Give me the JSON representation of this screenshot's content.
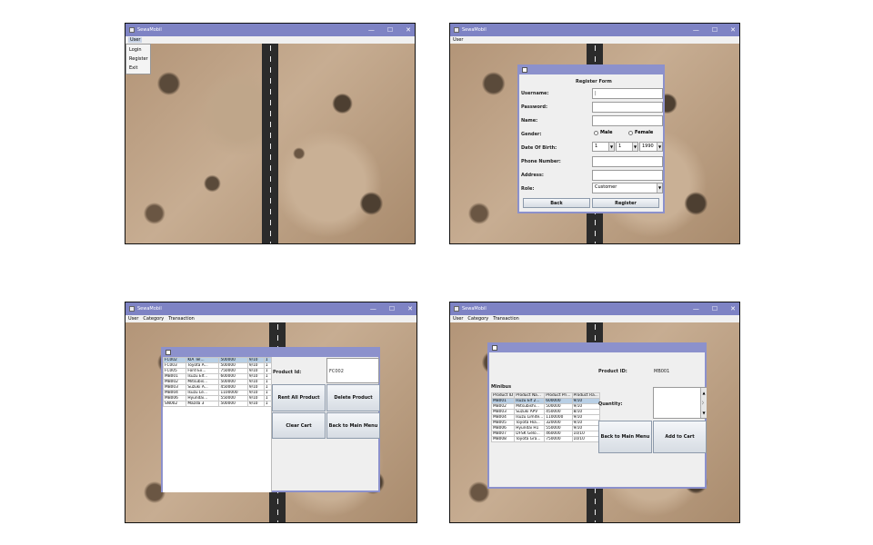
{
  "app_title": "SewaMobil",
  "window_controls": {
    "minimize": "—",
    "maximize": "☐",
    "close": "✕"
  },
  "panel1": {
    "menu": [
      "User"
    ],
    "dropdown": [
      "Login",
      "Register",
      "Exit"
    ]
  },
  "panel2": {
    "menu": [
      "User"
    ],
    "form_title": "Register Form",
    "labels": {
      "username": "Username:",
      "password": "Password:",
      "name": "Name:",
      "gender": "Gender:",
      "dob": "Date Of Birth:",
      "phone": "Phone Number:",
      "address": "Address:",
      "role": "Role:"
    },
    "gender_options": [
      "Male",
      "Female"
    ],
    "dob": {
      "day": "1",
      "month": "1",
      "year": "1990"
    },
    "role_value": "Customer",
    "back_button": "Back",
    "register_button": "Register"
  },
  "panel3": {
    "menu": [
      "User",
      "Category",
      "Transaction"
    ],
    "rows": [
      [
        "FC002",
        "KIA Tel...",
        "500000",
        "9/10",
        "1"
      ],
      [
        "FC003",
        "Toyota A...",
        "500000",
        "9/10",
        "1"
      ],
      [
        "FC005",
        "Ford Ex...",
        "750000",
        "9/10",
        "1"
      ],
      [
        "MB001",
        "Isuzu Elf...",
        "600000",
        "9/10",
        "1"
      ],
      [
        "MB002",
        "Mitsubis...",
        "500000",
        "9/10",
        "1"
      ],
      [
        "MB003",
        "Suzuki A...",
        "450000",
        "9/10",
        "1"
      ],
      [
        "MB004",
        "Isuzu Le...",
        "1100000",
        "9/10",
        "1"
      ],
      [
        "MB006",
        "Hyundai...",
        "550000",
        "9/10",
        "1"
      ],
      [
        "SN002",
        "Mazda 3",
        "500000",
        "9/10",
        "1"
      ]
    ],
    "product_id_label": "Product Id:",
    "product_id_value": "FC002",
    "rent_all_button": "Rent All Product",
    "delete_button": "Delete Product",
    "clear_cart_button": "Clear Cart",
    "back_menu_button": "Back to Main Menu"
  },
  "panel4": {
    "menu": [
      "User",
      "Category",
      "Transaction"
    ],
    "category_label": "Minibus",
    "product_id_label": "Product ID:",
    "product_id_value": "MB001",
    "quantity_label": "Quantity:",
    "headers": [
      "Product ID",
      "Product Na...",
      "Product Pri...",
      "Product Ra..."
    ],
    "rows": [
      [
        "MB001",
        "Isuzu Elf 2...",
        "600000",
        "9/10"
      ],
      [
        "MB002",
        "Mitsubishi...",
        "500000",
        "9/10"
      ],
      [
        "MB003",
        "Suzuki APV",
        "450000",
        "8/10"
      ],
      [
        "MB004",
        "Isuzu Limite...",
        "1100000",
        "9/10"
      ],
      [
        "MB005",
        "Toyota Hia...",
        "320000",
        "9/10"
      ],
      [
        "MB006",
        "Hyundai H1",
        "550000",
        "9/10"
      ],
      [
        "MB007",
        "DFSK Gelo...",
        "460000",
        "10/10"
      ],
      [
        "MB008",
        "Toyota Gra...",
        "750000",
        "10/10"
      ]
    ],
    "back_menu_button": "Back to Main Menu",
    "add_cart_button": "Add to Cart"
  }
}
